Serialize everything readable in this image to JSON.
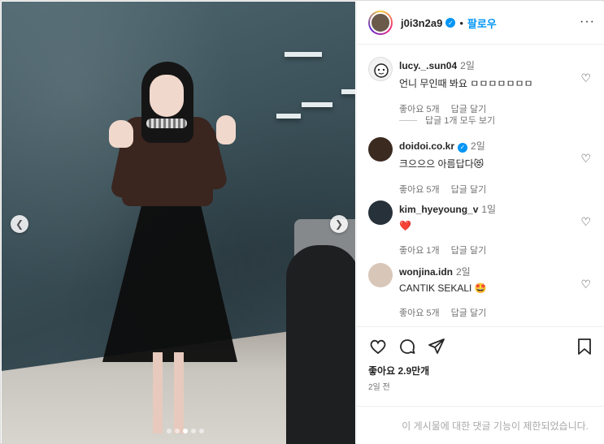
{
  "post": {
    "username": "j0i3n2a9",
    "follow_label": "팔로우",
    "separator": "•",
    "more_label": "···"
  },
  "comments": [
    {
      "user": "lucy._.sun04",
      "time": "2일",
      "text": "언니 무인때 봐요 ㅁㅁㅁㅁㅁㅁㅁ",
      "likes": "좋아요 5개",
      "reply": "답글 달기",
      "avatar_color": "#e7e7e7"
    },
    {
      "user": "doidoi.co.kr",
      "time": "2일",
      "text": "크으으으 아름답다😻",
      "likes": "좋아요 5개",
      "reply": "답글 달기",
      "avatar_color": "#3b2a20",
      "verified": true
    },
    {
      "user": "kim_hyeyoung_v",
      "time": "1일",
      "text": "❤️",
      "likes": "좋아요 1개",
      "reply": "답글 달기",
      "avatar_color": "#26313a"
    },
    {
      "user": "wonjina.idn",
      "time": "2일",
      "text": "CANTIK SEKALI 🤩",
      "likes": "좋아요 5개",
      "reply": "답글 달기",
      "avatar_color": "#d8c7b8"
    }
  ],
  "view_replies": "답글 1개 모두 보기",
  "footer": {
    "likes": "좋아요 2.9만개",
    "posted": "2일 전",
    "restricted": "이 게시물에 대한 댓글 기능이 제한되었습니다."
  },
  "icons": {
    "heart": "heart-icon",
    "comment": "comment-icon",
    "share": "share-icon",
    "save": "bookmark-icon",
    "verified": "verified-badge-icon"
  },
  "colors": {
    "accent": "#0095f6",
    "muted": "#737373",
    "restricted": "#a8a8a8"
  }
}
